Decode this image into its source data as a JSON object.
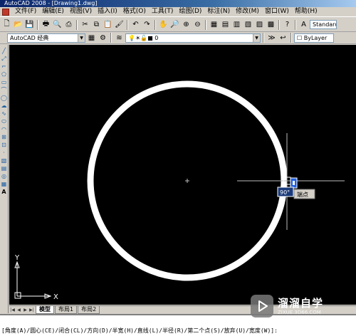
{
  "window": {
    "title": "AutoCAD 2008 - [Drawing1.dwg]"
  },
  "menubar": {
    "items": [
      "文件(F)",
      "编辑(E)",
      "视图(V)",
      "插入(I)",
      "格式(O)",
      "工具(T)",
      "绘图(D)",
      "标注(N)",
      "修改(M)",
      "窗口(W)",
      "帮助(H)"
    ]
  },
  "toolbar": {
    "style_combo": "Standard"
  },
  "workspace": {
    "combo": "AutoCAD 经典"
  },
  "layer": {
    "current": "0",
    "linetype": "ByLayer"
  },
  "canvas": {
    "tooltip_angle": "90°",
    "tooltip_label": "端点",
    "ucs_x": "X",
    "ucs_y": "Y"
  },
  "tabs": {
    "model": "模型",
    "layout1": "布局1",
    "layout2": "布局2"
  },
  "command": {
    "prompt": "[角度(A)/圆心(CE)/闭合(CL)/方向(D)/半宽(H)/直线(L)/半径(R)/第二个点(S)/放弃(U)/宽度(W)]:"
  },
  "watermark": {
    "title": "溜溜自学",
    "url": "ZIXUE.3D66.COM"
  },
  "colors": {
    "canvas": "#000000",
    "entity": "#ffffff",
    "tooltip_bg": "#1a3a7a"
  }
}
